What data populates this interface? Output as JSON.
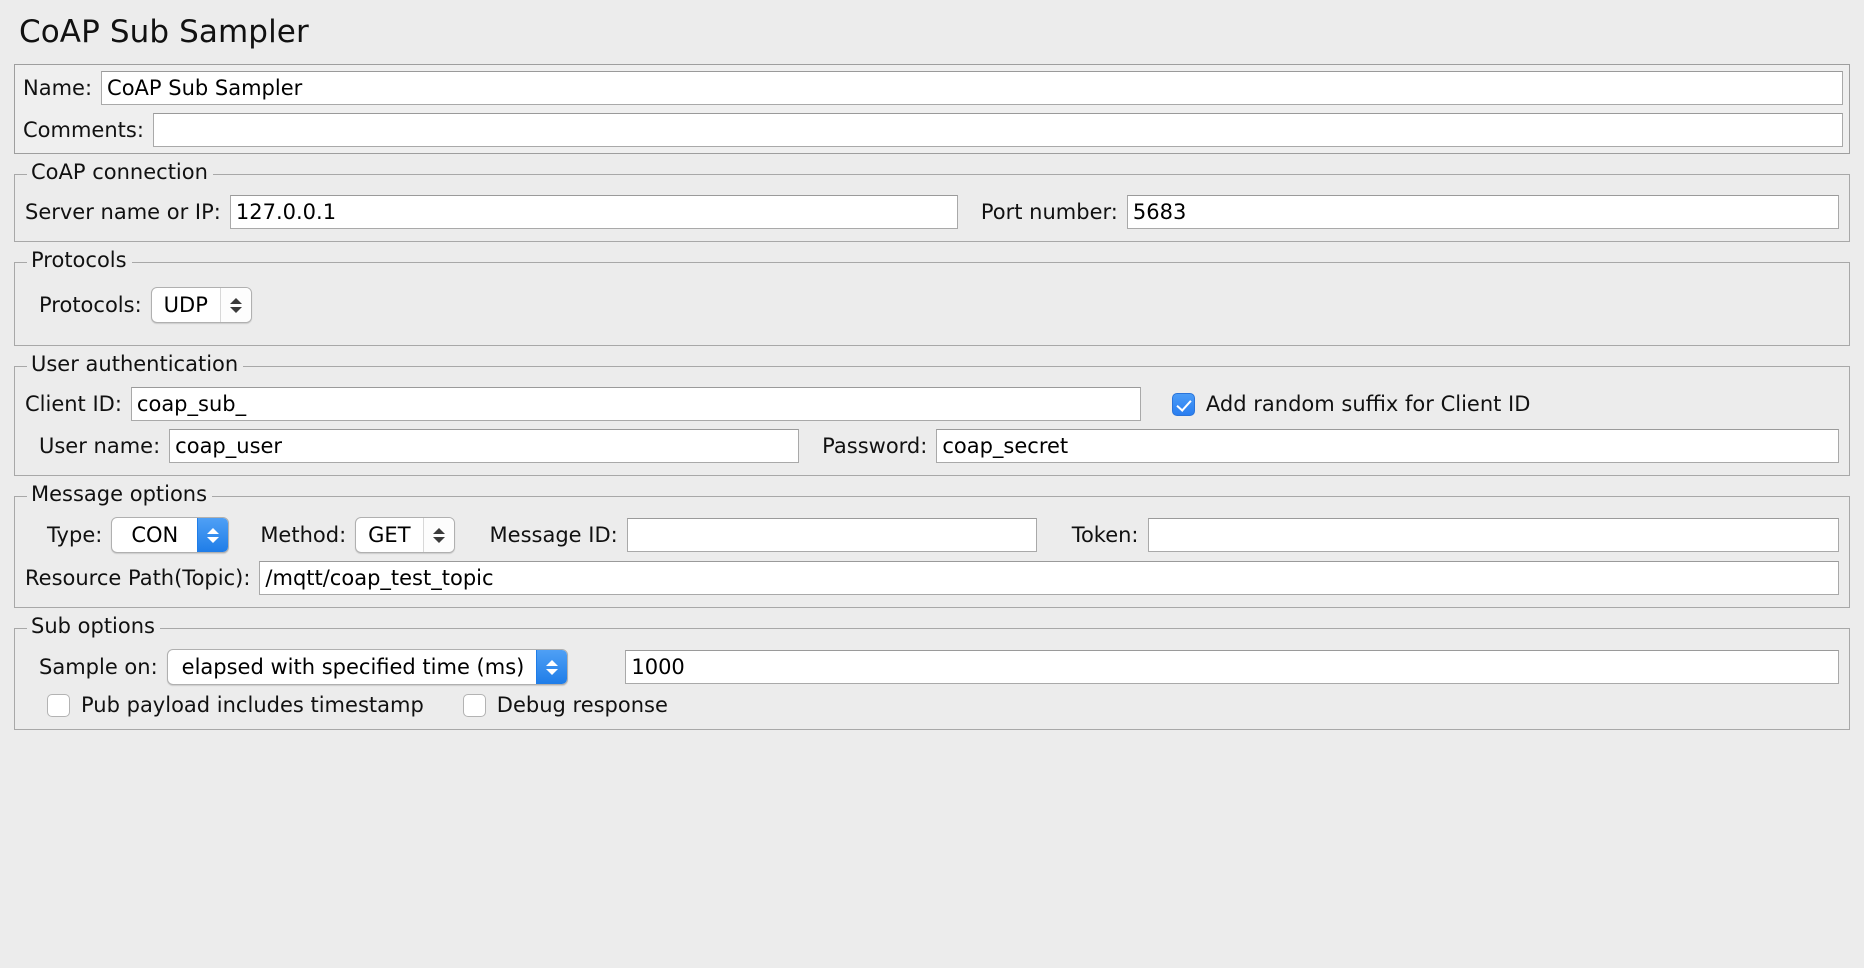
{
  "page_title": "CoAP Sub Sampler",
  "header": {
    "name_label": "Name:",
    "name_value": "CoAP Sub Sampler",
    "comments_label": "Comments:",
    "comments_value": ""
  },
  "coap_connection": {
    "title": "CoAP connection",
    "server_label": "Server name or IP:",
    "server_value": "127.0.0.1",
    "port_label": "Port number:",
    "port_value": "5683"
  },
  "protocols": {
    "title": "Protocols",
    "label": "Protocols:",
    "value": "UDP",
    "accent": false
  },
  "user_authentication": {
    "title": "User authentication",
    "client_id_label": "Client ID:",
    "client_id_value": "coap_sub_",
    "random_suffix_label": "Add random suffix for Client ID",
    "random_suffix_checked": true,
    "user_name_label": "User name:",
    "user_name_value": "coap_user",
    "password_label": "Password:",
    "password_value": "coap_secret"
  },
  "message_options": {
    "title": "Message options",
    "type_label": "Type:",
    "type_value": "CON",
    "type_accent": true,
    "method_label": "Method:",
    "method_value": "GET",
    "method_accent": false,
    "message_id_label": "Message ID:",
    "message_id_value": "",
    "token_label": "Token:",
    "token_value": "",
    "resource_path_label": "Resource Path(Topic):",
    "resource_path_value": "/mqtt/coap_test_topic"
  },
  "sub_options": {
    "title": "Sub options",
    "sample_on_label": "Sample on:",
    "sample_on_value": "elapsed with specified time (ms)",
    "sample_on_accent": true,
    "sample_time_value": "1000",
    "pub_timestamp_label": "Pub payload includes timestamp",
    "pub_timestamp_checked": false,
    "debug_response_label": "Debug response",
    "debug_response_checked": false
  },
  "colors": {
    "accent_blue": "#2a7ef0",
    "window_bg": "#ececec",
    "field_bg": "#ffffff",
    "border": "#a8a8a8"
  }
}
